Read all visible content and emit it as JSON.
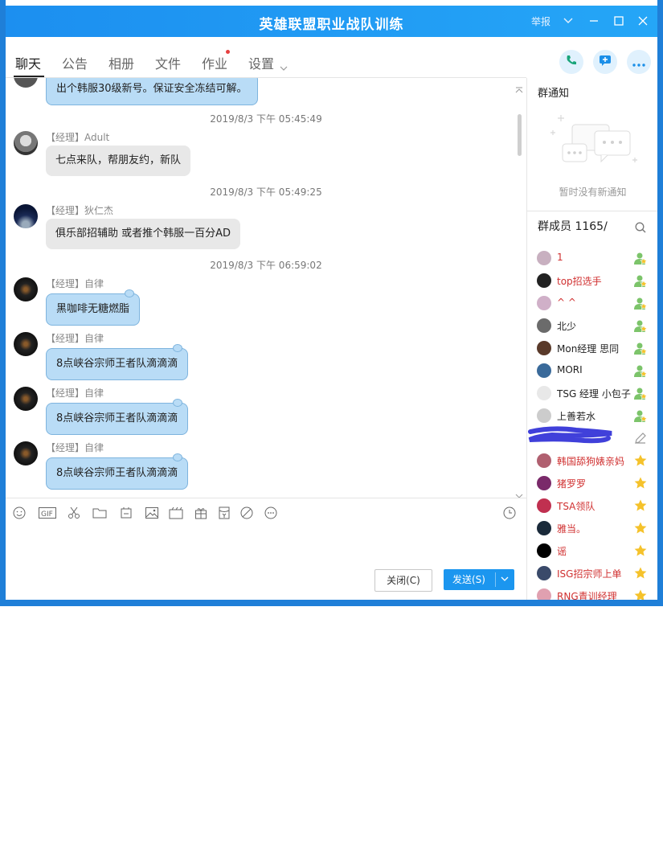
{
  "window": {
    "title": "英雄联盟职业战队训练",
    "report_label": "举报"
  },
  "tabs": [
    {
      "label": "聊天"
    },
    {
      "label": "公告"
    },
    {
      "label": "相册"
    },
    {
      "label": "文件"
    },
    {
      "label": "作业"
    },
    {
      "label": "设置"
    }
  ],
  "messages": [
    {
      "text": "出个韩服30级新号。保证安全冻结可解。"
    },
    {
      "time": "2019/8/3 下午 05:45:49",
      "sender": "【经理】Adult",
      "text": "七点来队，帮朋友约，新队"
    },
    {
      "time": "2019/8/3 下午 05:49:25",
      "sender": "【经理】狄仁杰",
      "text": "俱乐部招辅助  或者推个韩服一百分AD"
    },
    {
      "time": "2019/8/3 下午 06:59:02",
      "sender": "【经理】自律",
      "text": "黑咖啡无糖燃脂"
    },
    {
      "sender": "【经理】自律",
      "text": "8点峡谷宗师王者队滴滴滴"
    },
    {
      "sender": "【经理】自律",
      "text": "8点峡谷宗师王者队滴滴滴"
    },
    {
      "sender": "【经理】自律",
      "text": "8点峡谷宗师王者队滴滴滴"
    }
  ],
  "composer": {
    "close_label": "关闭(C)",
    "send_label": "发送(S)"
  },
  "sidebar": {
    "notice_title": "群通知",
    "notice_empty": "暂时没有新通知",
    "members_title": "群成员",
    "members_count": "1165/",
    "members": [
      {
        "name": "1",
        "color": "#d03030",
        "badge": "admin-badge"
      },
      {
        "name": "top招选手",
        "color": "#d03030",
        "badge": "admin-badge"
      },
      {
        "name": "^ ^",
        "color": "#d03030",
        "badge": "admin-badge"
      },
      {
        "name": "北少",
        "color": "#222222",
        "badge": "admin-badge"
      },
      {
        "name": "Mon经理 思同",
        "color": "#222222",
        "badge": "admin-badge"
      },
      {
        "name": "MORI",
        "color": "#222222",
        "badge": "admin-badge"
      },
      {
        "name": "TSG 经理 小包子",
        "color": "#222222",
        "badge": "admin-badge"
      },
      {
        "name": "上善若水",
        "color": "#222222",
        "badge": "admin-badge"
      },
      {
        "name": "",
        "color": "#222222",
        "badge": "edit-icon"
      },
      {
        "name": "韩国舔狗婊亲妈",
        "color": "#d03030",
        "badge": "star-icon"
      },
      {
        "name": "猪罗罗",
        "color": "#d03030",
        "badge": "star-icon"
      },
      {
        "name": "TSA领队",
        "color": "#d03030",
        "badge": "star-icon"
      },
      {
        "name": "雅当。",
        "color": "#d03030",
        "badge": "star-icon"
      },
      {
        "name": "谣",
        "color": "#d03030",
        "badge": "star-icon"
      },
      {
        "name": "ISG招宗师上单",
        "color": "#d03030",
        "badge": "star-icon"
      },
      {
        "name": "RNG青训经理",
        "color": "#d03030",
        "badge": "star-icon"
      }
    ]
  }
}
